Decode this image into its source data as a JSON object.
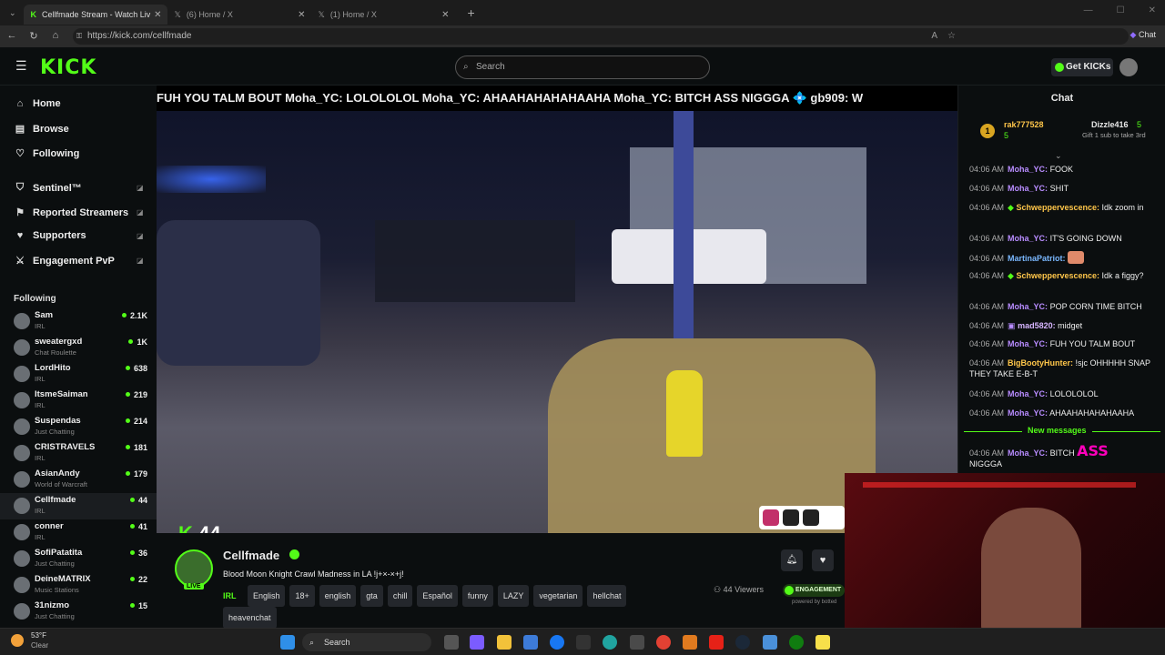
{
  "browser": {
    "tabs": [
      {
        "title": "Cellfmade Stream - Watch Liv",
        "active": true
      },
      {
        "title": "(6) Home / X",
        "active": false
      },
      {
        "title": "(1) Home / X",
        "active": false
      }
    ],
    "url": "https://kick.com/cellfmade",
    "chat_btn": "Chat"
  },
  "header": {
    "logo": "KICK",
    "search_placeholder": "Search",
    "get_kicks": "Get KICKs"
  },
  "sidebar": {
    "nav": [
      {
        "label": "Home",
        "icon": "home-icon"
      },
      {
        "label": "Browse",
        "icon": "browse-icon"
      },
      {
        "label": "Following",
        "icon": "heart-icon"
      },
      {
        "label": "Sentinel™",
        "icon": "shield-icon"
      },
      {
        "label": "Reported Streamers",
        "icon": "flag-icon"
      },
      {
        "label": "Supporters",
        "icon": "heart-icon"
      },
      {
        "label": "Engagement PvP",
        "icon": "swords-icon"
      }
    ],
    "following_heading": "Following",
    "following": [
      {
        "name": "Sam",
        "category": "IRL",
        "viewers": "2.1K"
      },
      {
        "name": "sweatergxd",
        "category": "Chat Roulette",
        "viewers": "1K"
      },
      {
        "name": "LordHito",
        "category": "IRL",
        "viewers": "638"
      },
      {
        "name": "ItsmeSaiman",
        "category": "IRL",
        "viewers": "219"
      },
      {
        "name": "Suspendas",
        "category": "Just Chatting",
        "viewers": "214"
      },
      {
        "name": "CRISTRAVELS",
        "category": "IRL",
        "viewers": "181"
      },
      {
        "name": "AsianAndy",
        "category": "World of Warcraft",
        "viewers": "179"
      },
      {
        "name": "Cellfmade",
        "category": "IRL",
        "viewers": "44"
      },
      {
        "name": "conner",
        "category": "IRL",
        "viewers": "41"
      },
      {
        "name": "SofiPatatita",
        "category": "Just Chatting",
        "viewers": "36"
      },
      {
        "name": "DeineMATRIX",
        "category": "Music Stations",
        "viewers": "22"
      },
      {
        "name": "31nizmo",
        "category": "Just Chatting",
        "viewers": "15"
      }
    ]
  },
  "player": {
    "marquee": "FUH YOU TALM BOUT Moha_YC: LOLOLOLOL Moha_YC: AHAAHAHAHAHAAHA Moha_YC: BITCH ASS NIGGGA 💠 gb909: W",
    "viewer_overlay": "44"
  },
  "stream": {
    "channel": "Cellfmade",
    "title": "Blood Moon Knight Crawl Madness in LA !j+×-×+j!",
    "category": "IRL",
    "tags": [
      "English",
      "18+",
      "english",
      "gta",
      "chill",
      "Español",
      "funny",
      "LAZY",
      "vegetarian",
      "hellchat",
      "heavenchat"
    ],
    "viewers": "44 Viewers",
    "engagement": "ENGAGEMENT",
    "powered": "powered by botted"
  },
  "chat": {
    "title": "Chat",
    "gifters": [
      {
        "rank": "1",
        "name": "rak777528",
        "count": "5"
      },
      {
        "name": "Dizzle416",
        "count": "5",
        "note": "Gift 1 sub to take 3rd"
      }
    ],
    "messages": [
      {
        "time": "04:06 AM",
        "user": "Moha_YC:",
        "text": "FOOK",
        "color": "#b88cff"
      },
      {
        "time": "04:06 AM",
        "user": "Moha_YC:",
        "text": "SHIT",
        "color": "#b88cff"
      },
      {
        "time": "04:06 AM",
        "user": "Schwepp­ervescence:",
        "text": "Idk zoom in",
        "color": "#ffc64a"
      },
      {
        "time": "04:06 AM",
        "user": "Moha_YC:",
        "text": "IT'S GOING DOWN",
        "color": "#b88cff"
      },
      {
        "time": "04:06 AM",
        "user": "MartinaPatriot:",
        "text": "",
        "color": "#7ab8ff"
      },
      {
        "time": "04:06 AM",
        "user": "Schwepp­ervescence:",
        "text": "Idk a figgy?",
        "color": "#ffc64a"
      },
      {
        "time": "04:06 AM",
        "user": "Moha_YC:",
        "text": "POP CORN TIME BITCH",
        "color": "#b88cff"
      },
      {
        "time": "04:06 AM",
        "user": "mad5820:",
        "text": "midget",
        "color": "#d7b5ff"
      },
      {
        "time": "04:06 AM",
        "user": "Moha_YC:",
        "text": "FUH YOU TALM BOUT",
        "color": "#b88cff"
      },
      {
        "time": "04:06 AM",
        "user": "BigBootyHunter:",
        "text": "!sjc OHHHHH SNAP THEY TAKE E-B-T",
        "color": "#ffc64a"
      },
      {
        "time": "04:06 AM",
        "user": "Moha_YC:",
        "text": "LOLOLOLOL",
        "color": "#b88cff"
      },
      {
        "time": "04:06 AM",
        "user": "Moha_YC:",
        "text": "AHAAHAHAHAHAAHA",
        "color": "#b88cff"
      }
    ],
    "new_messages": "New messages",
    "last_msg": {
      "time": "04:06 AM",
      "user": "Moha_YC:",
      "text": "BITCH",
      "text2": "NIGGGA",
      "emote": "ASS"
    }
  },
  "taskbar": {
    "weather_temp": "53°F",
    "weather_desc": "Clear",
    "search": "Search"
  },
  "colors": {
    "accent": "#53fc18",
    "bg": "#0b0e0f"
  }
}
